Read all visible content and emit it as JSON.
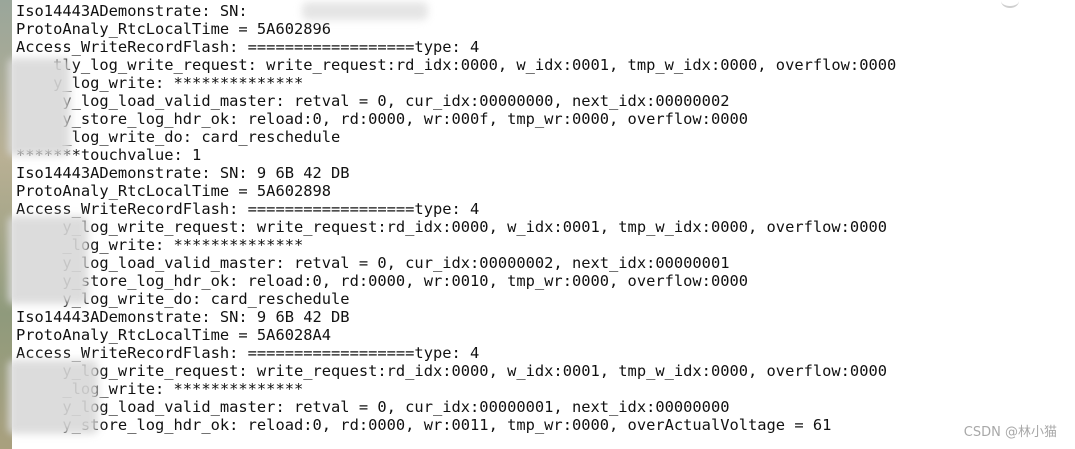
{
  "log_lines": [
    "Iso14443ADemonstrate: SN:",
    "ProtoAnaly_RtcLocalTime = 5A602896",
    "Access_WriteRecordFlash: ==================type: 4",
    "    tly_log_write_request: write_request:rd_idx:0000, w_idx:0001, tmp_w_idx:0000, overflow:0000",
    "    y_log_write: **************",
    "     y_log_load_valid_master: retval = 0, cur_idx:00000000, next_idx:00000002",
    "     y_store_log_hdr_ok: reload:0, rd:0000, wr:000f, tmp_wr:0000, overflow:0000",
    "     _log_write_do: card_reschedule",
    "*******touchvalue: 1",
    "Iso14443ADemonstrate: SN: 9 6B 42 DB",
    "ProtoAnaly_RtcLocalTime = 5A602898",
    "Access_WriteRecordFlash: ==================type: 4",
    "     y_log_write_request: write_request:rd_idx:0000, w_idx:0001, tmp_w_idx:0000, overflow:0000",
    "     _log_write: **************",
    "     y_log_load_valid_master: retval = 0, cur_idx:00000002, next_idx:00000001",
    "     y_store_log_hdr_ok: reload:0, rd:0000, wr:0010, tmp_wr:0000, overflow:0000",
    "     y_log_write_do: card_reschedule",
    "Iso14443ADemonstrate: SN: 9 6B 42 DB",
    "ProtoAnaly_RtcLocalTime = 5A6028A4",
    "Access_WriteRecordFlash: ==================type: 4",
    "     y_log_write_request: write_request:rd_idx:0000, w_idx:0001, tmp_w_idx:0000, overflow:0000",
    "     _log_write: **************",
    "     y_log_load_valid_master: retval = 0, cur_idx:00000001, next_idx:00000000",
    "     y_store_log_hdr_ok: reload:0, rd:0000, wr:0011, tmp_wr:0000, overActualVoltage = 61"
  ],
  "watermark": "CSDN @林小猫"
}
